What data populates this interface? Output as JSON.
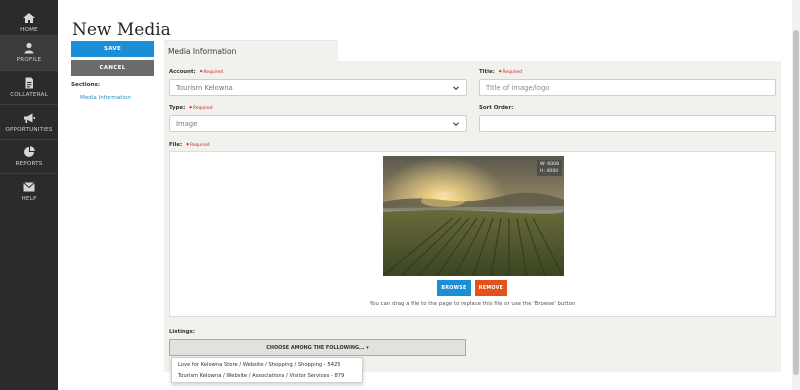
{
  "nav": {
    "items": [
      {
        "label": "HOME",
        "icon": "home-icon"
      },
      {
        "label": "PROFILE",
        "icon": "user-icon"
      },
      {
        "label": "COLLATERAL",
        "icon": "document-icon"
      },
      {
        "label": "OPPORTUNITIES",
        "icon": "megaphone-icon"
      },
      {
        "label": "REPORTS",
        "icon": "pie-chart-icon"
      },
      {
        "label": "HELP",
        "icon": "envelope-icon"
      }
    ]
  },
  "page": {
    "title": "New Media"
  },
  "actions": {
    "save_label": "SAVE",
    "cancel_label": "CANCEL"
  },
  "sections": {
    "label": "Sections:",
    "items": [
      "Media Information"
    ]
  },
  "panel": {
    "tab_label": "Media Information"
  },
  "form": {
    "required_text": "Required",
    "account": {
      "label": "Account:",
      "value": "Tourism Kelowna"
    },
    "title": {
      "label": "Title:",
      "placeholder": "Title of image/logo"
    },
    "type": {
      "label": "Type:",
      "value": "Image"
    },
    "sort_order": {
      "label": "Sort Order:",
      "value": ""
    },
    "file": {
      "label": "File:",
      "width_text": "W: 6008",
      "height_text": "H: 4000",
      "browse_label": "BROWSE",
      "remove_label": "REMOVE",
      "hint": "You can drag a file to the page to replace this file or use the 'Browse' button"
    },
    "listings": {
      "label": "Listings:",
      "choose_label": "CHOOSE AMONG THE FOLLOWING... ▾",
      "options": [
        "Love for Kelowna Store / Website / Shopping / Shopping - 5425",
        "Tourism Kelowna / Website / Associations / Visitor Services - 879"
      ]
    }
  },
  "colors": {
    "sidebar": "#2b2b2b",
    "primary": "#1b8fd6",
    "danger": "#e4521b",
    "required": "#cc2a1f",
    "panel": "#f1f1ee"
  }
}
